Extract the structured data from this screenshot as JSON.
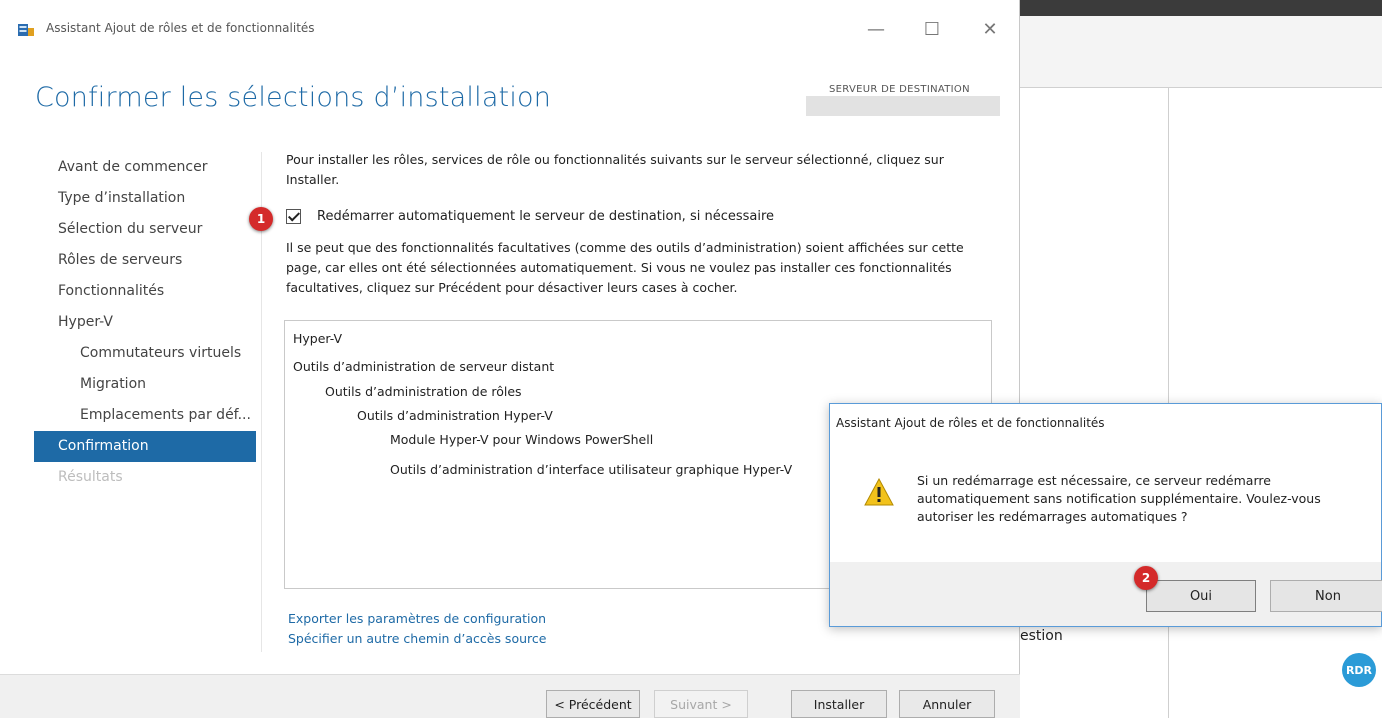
{
  "window": {
    "title": "Assistant Ajout de rôles et de fonctionnalités",
    "minimize": "—",
    "maximize": "☐",
    "close": "✕"
  },
  "page": {
    "title": "Confirmer les sélections d’installation",
    "destination_label": "SERVEUR DE DESTINATION"
  },
  "nav": {
    "items": [
      {
        "label": "Avant de commencer"
      },
      {
        "label": "Type d’installation"
      },
      {
        "label": "Sélection du serveur"
      },
      {
        "label": "Rôles de serveurs"
      },
      {
        "label": "Fonctionnalités"
      },
      {
        "label": "Hyper-V"
      },
      {
        "label": "Commutateurs virtuels"
      },
      {
        "label": "Migration"
      },
      {
        "label": "Emplacements par déf..."
      },
      {
        "label": "Confirmation"
      },
      {
        "label": "Résultats"
      }
    ]
  },
  "content": {
    "intro": "Pour installer les rôles, services de rôle ou fonctionnalités suivants sur le serveur sélectionné, cliquez sur Installer.",
    "restart_checkbox_label": "Redémarrer automatiquement le serveur de destination, si nécessaire",
    "note": "Il se peut que des fonctionnalités facultatives (comme des outils d’administration) soient affichées sur cette page, car elles ont été sélectionnées automatiquement. Si vous ne voulez pas installer ces fonctionnalités facultatives, cliquez sur Précédent pour désactiver leurs cases à cocher.",
    "features": [
      "Hyper-V",
      "Outils d’administration de serveur distant",
      "Outils d’administration de rôles",
      "Outils d’administration Hyper-V",
      "Module Hyper-V pour Windows PowerShell",
      "Outils d’administration d’interface utilisateur graphique Hyper-V"
    ],
    "export_link": "Exporter les paramètres de configuration",
    "source_link": "Spécifier un autre chemin d’accès source"
  },
  "footer": {
    "previous": "< Précédent",
    "next": "Suivant >",
    "install": "Installer",
    "cancel": "Annuler"
  },
  "dialog": {
    "title": "Assistant Ajout de rôles et de fonctionnalités",
    "message": "Si un redémarrage est nécessaire, ce serveur redémarre automatiquement sans notification supplémentaire. Voulez-vous autoriser les redémarrages automatiques ?",
    "yes": "Oui",
    "no": "Non"
  },
  "markers": {
    "one": "1",
    "two": "2"
  },
  "background": {
    "partial_text": "estion",
    "badge": "RDR"
  },
  "colors": {
    "accent": "#1e6aa6",
    "marker": "#d42a2a",
    "warning": "#f2c21b"
  }
}
